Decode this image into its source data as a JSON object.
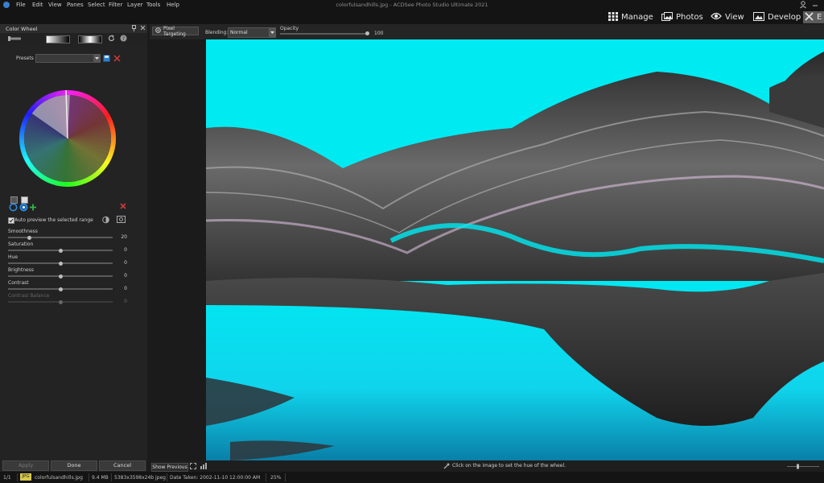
{
  "app": {
    "window_title": "colorfulsandhills.jpg - ACDSee Photo Studio Ultimate 2021",
    "menu": [
      "File",
      "Edit",
      "View",
      "Panes",
      "Select",
      "Filter",
      "Layer",
      "Tools",
      "Help"
    ]
  },
  "modes": [
    {
      "label": "Manage",
      "icon": "grid-icon"
    },
    {
      "label": "Photos",
      "icon": "photos-icon"
    },
    {
      "label": "View",
      "icon": "eye-icon"
    },
    {
      "label": "Develop",
      "icon": "develop-icon"
    },
    {
      "label": "E",
      "icon": "edit-tools-icon"
    }
  ],
  "panel": {
    "title": "Color Wheel",
    "presets_label": "Presets",
    "presets_value": "",
    "auto_preview_label": "Auto preview the selected range",
    "auto_preview_checked": true,
    "sliders": [
      {
        "label": "Smoothness",
        "value": "20",
        "fraction": 0.2,
        "enabled": true
      },
      {
        "label": "Saturation",
        "value": "0",
        "fraction": 0.5,
        "enabled": true
      },
      {
        "label": "Hue",
        "value": "0",
        "fraction": 0.5,
        "enabled": true
      },
      {
        "label": "Brightness",
        "value": "0",
        "fraction": 0.5,
        "enabled": true
      },
      {
        "label": "Contrast",
        "value": "0",
        "fraction": 0.5,
        "enabled": true
      },
      {
        "label": "Contrast Balance",
        "value": "0",
        "fraction": 0.5,
        "enabled": false
      }
    ],
    "buttons": {
      "apply": "Apply",
      "done": "Done",
      "cancel": "Cancel"
    }
  },
  "tool_options": {
    "pixel_targeting": "Pixel Targeting",
    "blending_label": "Blending:",
    "blending_value": "Normal",
    "opacity_label": "Opacity",
    "opacity_value": "100",
    "opacity_fraction": 1.0
  },
  "hint": {
    "show_previous": "Show Previous",
    "message": "Click on the image to set the hue of the wheel."
  },
  "status": {
    "index": "1/1",
    "format": "JPG",
    "filename": "colorfulsandhills.jpg",
    "size": "9.4 MB",
    "dimensions": "5383x3598x24b jpeg",
    "date_taken": "Date Taken: 2002-11-10 12:00:00 AM",
    "zoom": "25%"
  },
  "colors": {
    "accent_cyan": "#00eaf2",
    "brand_blue": "#3a7fd0",
    "delete_red": "#d23a3a",
    "add_green": "#35b545"
  }
}
